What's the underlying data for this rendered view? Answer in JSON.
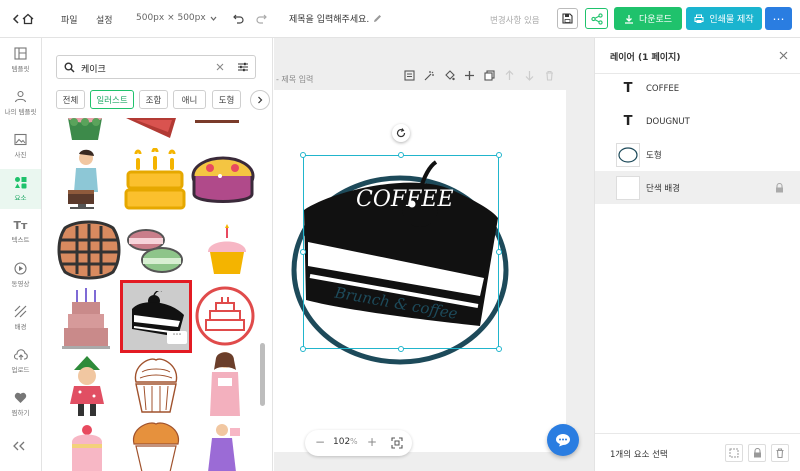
{
  "topbar": {
    "menu_file": "파일",
    "menu_settings": "설정",
    "size_label": "500px × 500px",
    "title_placeholder": "제목을 입력해주세요.",
    "save_status": "변경사항 있음",
    "download_label": "다운로드",
    "print_label": "인쇄물 제작"
  },
  "nav": [
    {
      "label": "템플릿",
      "icon": "template-icon"
    },
    {
      "label": "나의 템플릿",
      "icon": "my-template-icon"
    },
    {
      "label": "사진",
      "icon": "photo-icon"
    },
    {
      "label": "요소",
      "icon": "elements-icon"
    },
    {
      "label": "텍스트",
      "icon": "text-icon"
    },
    {
      "label": "동영상",
      "icon": "video-icon"
    },
    {
      "label": "배경",
      "icon": "background-icon"
    },
    {
      "label": "업로드",
      "icon": "upload-icon"
    },
    {
      "label": "찜하기",
      "icon": "favorite-icon"
    }
  ],
  "search": {
    "value": "케이크"
  },
  "chips": [
    "전체",
    "일러스트",
    "조합",
    "애니",
    "도형"
  ],
  "canvas": {
    "page_label": "- 제목 입력",
    "logo_text_top": "COFFEE",
    "logo_text_bottom": "Brunch & coffee",
    "zoom_value": "102",
    "zoom_unit": "%"
  },
  "layers_panel": {
    "title": "레이어 (1 페이지)",
    "layers": [
      {
        "name": "COFFEE",
        "type": "text"
      },
      {
        "name": "DOUGNUT",
        "type": "text"
      },
      {
        "name": "도형",
        "type": "shape"
      },
      {
        "name": "단색 배경",
        "type": "background"
      }
    ],
    "footer": "1개의 요소 선택"
  },
  "colors": {
    "accent_green": "#1fc26c",
    "teal": "#1ab4cf",
    "blue": "#2a7de1",
    "selection": "#21b5cc"
  }
}
